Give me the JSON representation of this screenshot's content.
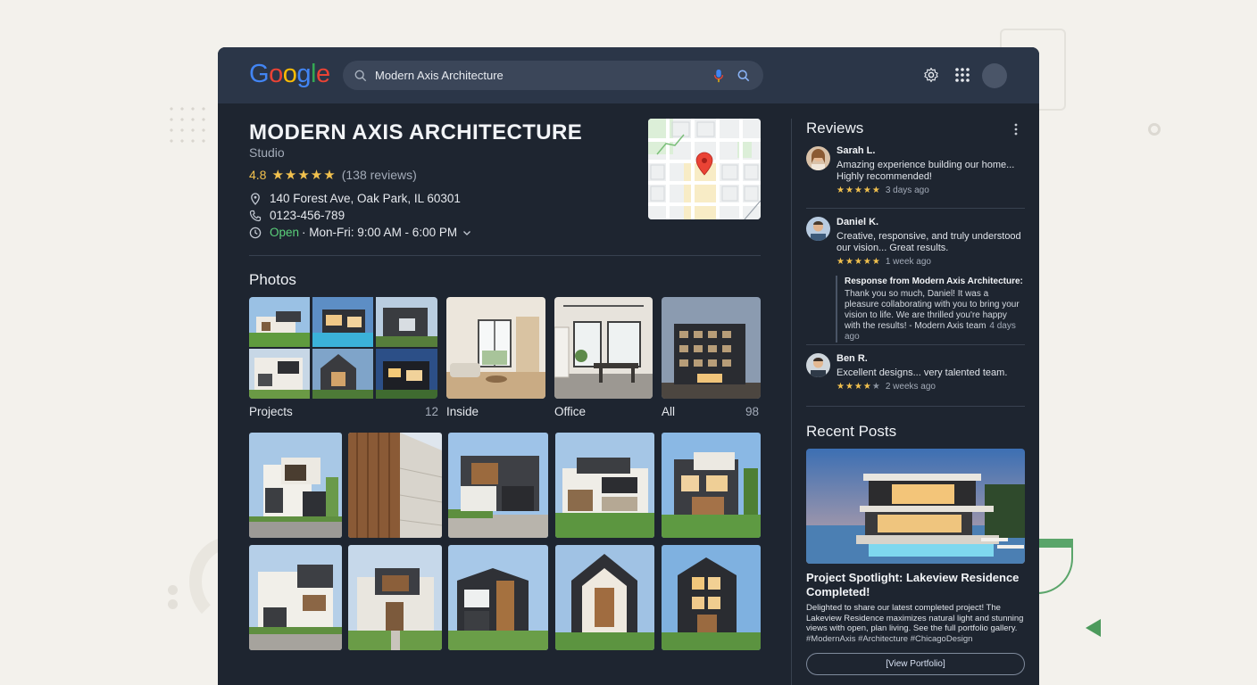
{
  "header": {
    "logo_letters": [
      "G",
      "o",
      "o",
      "g",
      "l",
      "e"
    ],
    "logo_colors": [
      "#4285F4",
      "#EA4335",
      "#FBBC05",
      "#4285F4",
      "#34A853",
      "#EA4335"
    ],
    "search_value": "Modern Axis Architecture",
    "icons": [
      "search-icon",
      "mic-icon",
      "lens-icon",
      "gear-icon",
      "apps-grid-icon",
      "account-avatar"
    ]
  },
  "business": {
    "name": "MODERN AXIS ARCHITECTURE",
    "category": "Studio",
    "rating": "4.8",
    "stars": "★★★★★",
    "reviews_count": "(138 reviews)",
    "address": "140 Forest Ave, Oak Park, IL 60301",
    "phone": "0123-456-789",
    "hours_status": "Open",
    "hours": " · Mon-Fri: 9:00 AM - 6:00 PM"
  },
  "photos": {
    "heading": "Photos",
    "categories": [
      {
        "label": "Projects",
        "count": "12"
      },
      {
        "label": "Inside",
        "count": ""
      },
      {
        "label": "Office",
        "count": ""
      },
      {
        "label": "All",
        "count": "98"
      }
    ]
  },
  "reviews": {
    "heading": "Reviews",
    "items": [
      {
        "name": "Sarah L.",
        "text": "Amazing experience building our home... Highly recommended!",
        "stars": "★★★★★",
        "time": "3 days ago"
      },
      {
        "name": "Daniel K.",
        "text": "Creative, responsive, and truly understood our vision... Great results.",
        "stars": "★★★★★",
        "time": "1 week ago"
      },
      {
        "name": "Ben R.",
        "text": "Excellent designs... very talented team.",
        "stars": "★★★★★",
        "time": "2 weeks ago"
      }
    ],
    "response": {
      "heading": "Response from Modern Axis Architecture:",
      "text": "Thank you so much, Daniel! It was a pleasure collaborating with you to bring your vision to life. We are thrilled you're happy with the results! - Modern Axis team",
      "time": "4 days ago"
    }
  },
  "posts": {
    "heading": "Recent Posts",
    "title": "Project Spotlight: Lakeview Residence Completed!",
    "body": "Delighted to share our latest completed project! The Lakeview Residence maximizes natural light and stunning views with open, plan living. See the full portfolio gallery.",
    "tags": "#ModernAxis #Architecture #ChicagoDesign",
    "button": "[View Portfolio]"
  },
  "colors": {
    "accent_star": "#f2c14e",
    "open_green": "#5bd17a",
    "panel_bg": "#1e2530",
    "topbar_bg": "#2b3648"
  }
}
